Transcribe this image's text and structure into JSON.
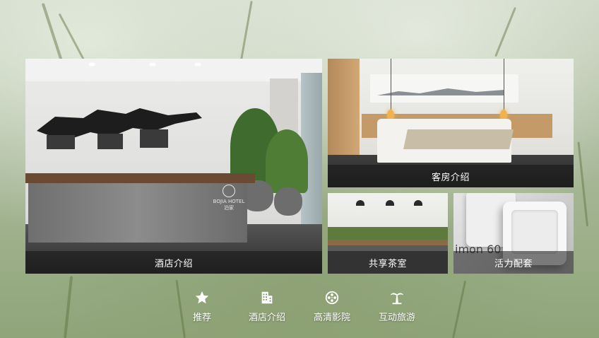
{
  "tiles": {
    "hotel": {
      "caption": "酒店介绍",
      "logo_text": "BOJIA HOTEL 泊家"
    },
    "room": {
      "caption": "客房介绍"
    },
    "tea": {
      "caption": "共享茶室"
    },
    "facility": {
      "caption": "活力配套",
      "brand_text": "imon 60"
    }
  },
  "nav": {
    "items": [
      {
        "label": "推荐",
        "icon": "star-icon"
      },
      {
        "label": "酒店介绍",
        "icon": "building-icon",
        "active": true
      },
      {
        "label": "高清影院",
        "icon": "film-reel-icon"
      },
      {
        "label": "互动旅游",
        "icon": "palm-tree-icon"
      }
    ]
  },
  "colors": {
    "background_top": "#c8d2bf",
    "background_bottom": "#8fa579",
    "caption_bar": "rgba(20,20,20,0.55)",
    "text": "#ffffff"
  }
}
